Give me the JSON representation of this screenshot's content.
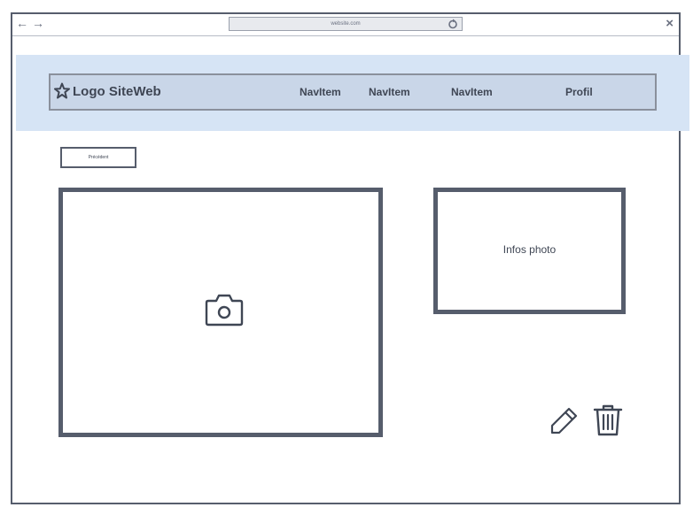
{
  "browser": {
    "url": "website.com",
    "back_icon": "arrow-left-icon",
    "forward_icon": "arrow-right-icon",
    "reload_icon": "reload-icon",
    "close_label": "×"
  },
  "navbar": {
    "logo_text": "Logo SiteWeb",
    "logo_icon": "star-icon",
    "items": [
      {
        "label": "NavItem"
      },
      {
        "label": "NavItem"
      },
      {
        "label": "NavItem"
      }
    ],
    "profile_label": "Profil"
  },
  "toolbar": {
    "previous_label": "Précédent"
  },
  "photo": {
    "placeholder_icon": "camera-icon"
  },
  "info": {
    "label": "Infos photo"
  },
  "actions": {
    "edit_icon": "pencil-icon",
    "delete_icon": "trash-icon"
  },
  "colors": {
    "header_band": "#d6e4f5",
    "navbar_bg": "#c9d6e8",
    "stroke": "#565d6c",
    "text": "#3f4654"
  }
}
